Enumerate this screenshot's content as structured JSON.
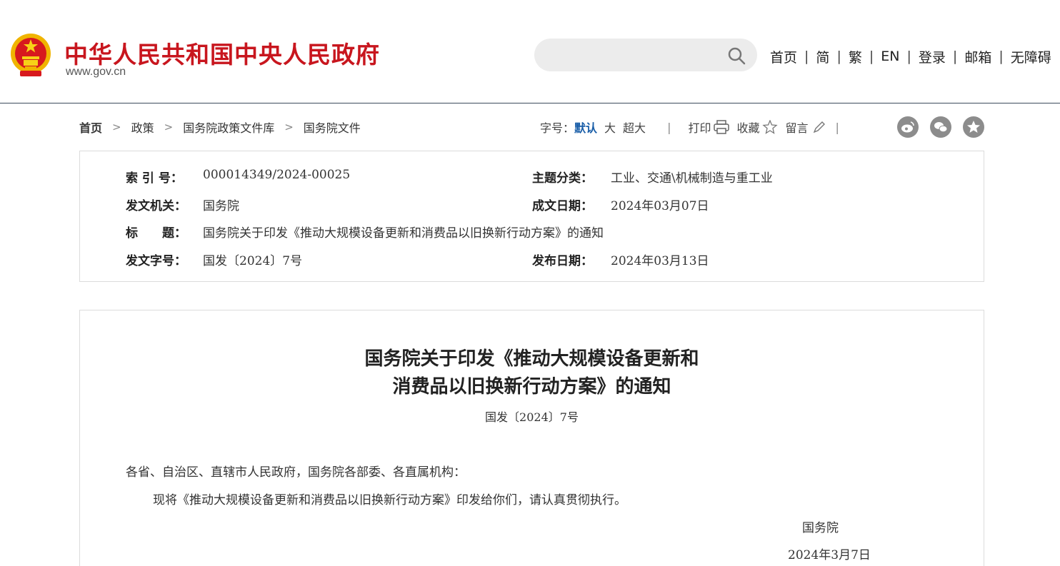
{
  "header": {
    "site_title": "中华人民共和国中央人民政府",
    "site_domain": "www.gov.cn",
    "search_placeholder": "",
    "nav": [
      "首页",
      "简",
      "繁",
      "EN",
      "登录",
      "邮箱",
      "无障碍"
    ]
  },
  "breadcrumb": {
    "items": [
      "首页",
      "政策",
      "国务院政策文件库",
      "国务院文件"
    ]
  },
  "tools": {
    "font_label": "字号：",
    "font_default": "默认",
    "font_large": "大",
    "font_xlarge": "超大",
    "print": "打印",
    "favorite": "收藏",
    "comment": "留言"
  },
  "share_icons": [
    "weibo-icon",
    "wechat-icon",
    "star-share-icon"
  ],
  "info": {
    "index_label": "索 引 号：",
    "index_value": "000014349/2024-00025",
    "topic_label": "主题分类：",
    "topic_value": "工业、交通\\机械制造与重工业",
    "issuer_label": "发文机关：",
    "issuer_value": "国务院",
    "date_written_label": "成文日期：",
    "date_written_value": "2024年03月07日",
    "title_label": "标　　题：",
    "title_value": "国务院关于印发《推动大规模设备更新和消费品以旧换新行动方案》的通知",
    "doc_no_label": "发文字号：",
    "doc_no_value": "国发〔2024〕7号",
    "publish_date_label": "发布日期：",
    "publish_date_value": "2024年03月13日"
  },
  "article": {
    "title_line1": "国务院关于印发《推动大规模设备更新和",
    "title_line2": "消费品以旧换新行动方案》的通知",
    "doc_no": "国发〔2024〕7号",
    "salutation": "各省、自治区、直辖市人民政府，国务院各部委、各直属机构：",
    "body": "现将《推动大规模设备更新和消费品以旧换新行动方案》印发给你们，请认真贯彻执行。",
    "signature": "国务院",
    "date": "2024年3月7日"
  },
  "colors": {
    "brand_red": "#c8161e",
    "link_blue": "#1a5ea8",
    "emblem_gold": "#f0b400"
  }
}
